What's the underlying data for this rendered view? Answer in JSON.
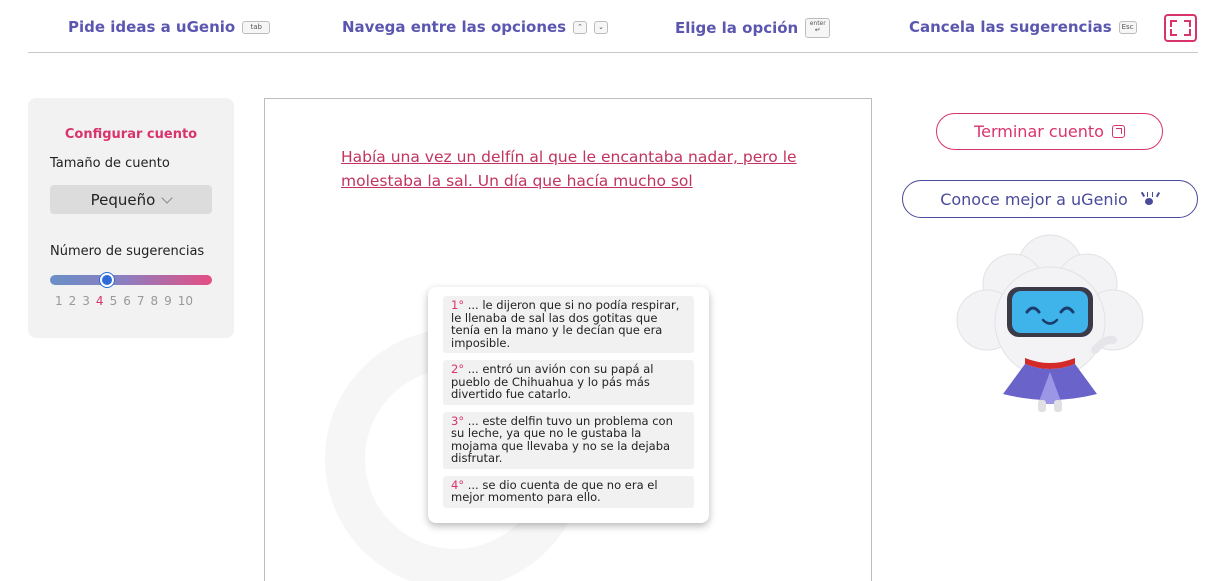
{
  "hints": [
    {
      "label": "Pide ideas a uGenio",
      "key": "tab"
    },
    {
      "label": "Navega entre las opciones",
      "key_up": "⌃",
      "key_down": "⌄"
    },
    {
      "label": "Elige la opción",
      "key": "enter"
    },
    {
      "label": "Cancela las sugerencias",
      "key": "Esc"
    }
  ],
  "config": {
    "title": "Configurar cuento",
    "size_label": "Tamaño de cuento",
    "size_value": "Pequeño",
    "suggestions_label": "Número de sugerencias",
    "suggestions_count": 4,
    "ticks": [
      "1",
      "2",
      "3",
      "4",
      "5",
      "6",
      "7",
      "8",
      "9",
      "10"
    ]
  },
  "story": {
    "text": "Había una vez un delfín al que le encantaba nadar, pero le molestaba la sal. Un día que hacía mucho sol"
  },
  "suggestions": [
    {
      "num": "1°",
      "text": " ... le dijeron que si no podía respirar, le llenaba de sal las dos gotitas que tenía en la mano y le decían que era imposible."
    },
    {
      "num": "2°",
      "text": " ... entró un avión con su papá al pueblo de Chihuahua y lo pás más divertido fue catarlo."
    },
    {
      "num": "3°",
      "text": " ... este delfin tuvo un problema con su leche, ya que no le gustaba la mojama que llevaba y no se la dejaba disfrutar."
    },
    {
      "num": "4°",
      "text": " ... se dio cuenta de que no era el mejor momento para ello."
    }
  ],
  "buttons": {
    "end_story": "Terminar cuento",
    "know_ugenio": "Conoce mejor a uGenio"
  },
  "colors": {
    "brand_pink": "#d9336d",
    "brand_purple": "#5b56b0"
  }
}
